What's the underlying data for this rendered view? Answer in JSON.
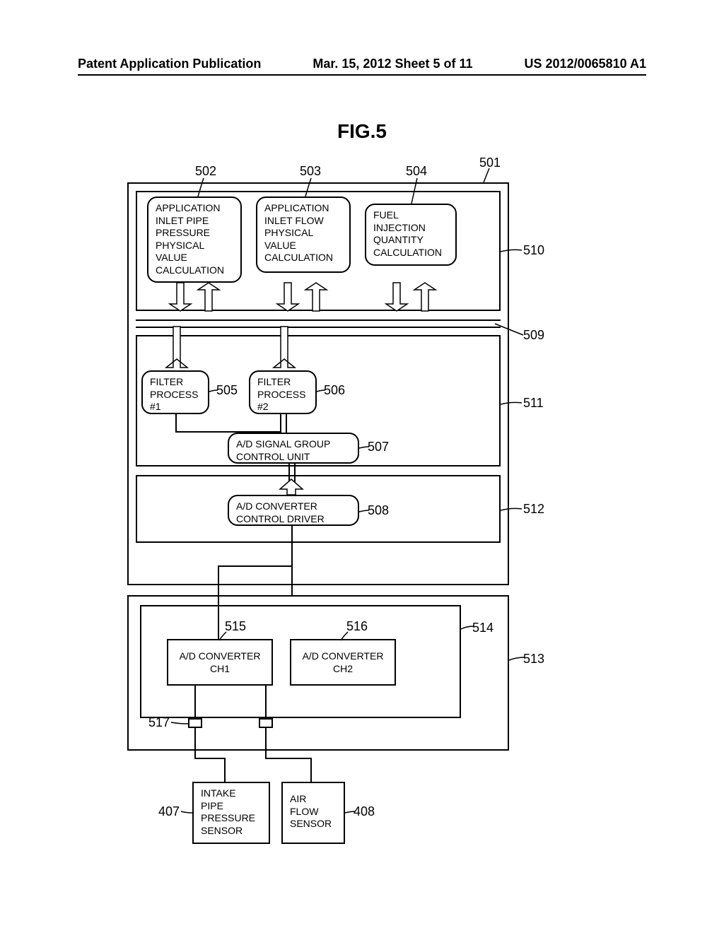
{
  "header": {
    "left": "Patent Application Publication",
    "center": "Mar. 15, 2012  Sheet 5 of 11",
    "right": "US 2012/0065810 A1"
  },
  "figure_title": "FIG.5",
  "blocks": {
    "b502": "APPLICATION\nINLET PIPE\nPRESSURE\nPHYSICAL\nVALUE\nCALCULATION",
    "b503": "APPLICATION\nINLET FLOW\nPHYSICAL\nVALUE\nCALCULATION",
    "b504": "FUEL\nINJECTION\nQUANTITY\nCALCULATION",
    "b505": "FILTER\nPROCESS\n#1",
    "b506": "FILTER\nPROCESS\n#2",
    "b507": "A/D SIGNAL GROUP\nCONTROL UNIT",
    "b508": "A/D CONVERTER\nCONTROL DRIVER",
    "b515": "A/D CONVERTER\nCH1",
    "b516": "A/D CONVERTER\nCH2",
    "b407": "INTAKE\nPIPE\nPRESSURE\nSENSOR",
    "b408": "AIR\nFLOW\nSENSOR"
  },
  "refs": {
    "r501": "501",
    "r502": "502",
    "r503": "503",
    "r504": "504",
    "r505": "505",
    "r506": "506",
    "r507": "507",
    "r508": "508",
    "r509": "509",
    "r510": "510",
    "r511": "511",
    "r512": "512",
    "r513": "513",
    "r514": "514",
    "r515": "515",
    "r516": "516",
    "r517": "517",
    "r407": "407",
    "r408": "408"
  }
}
